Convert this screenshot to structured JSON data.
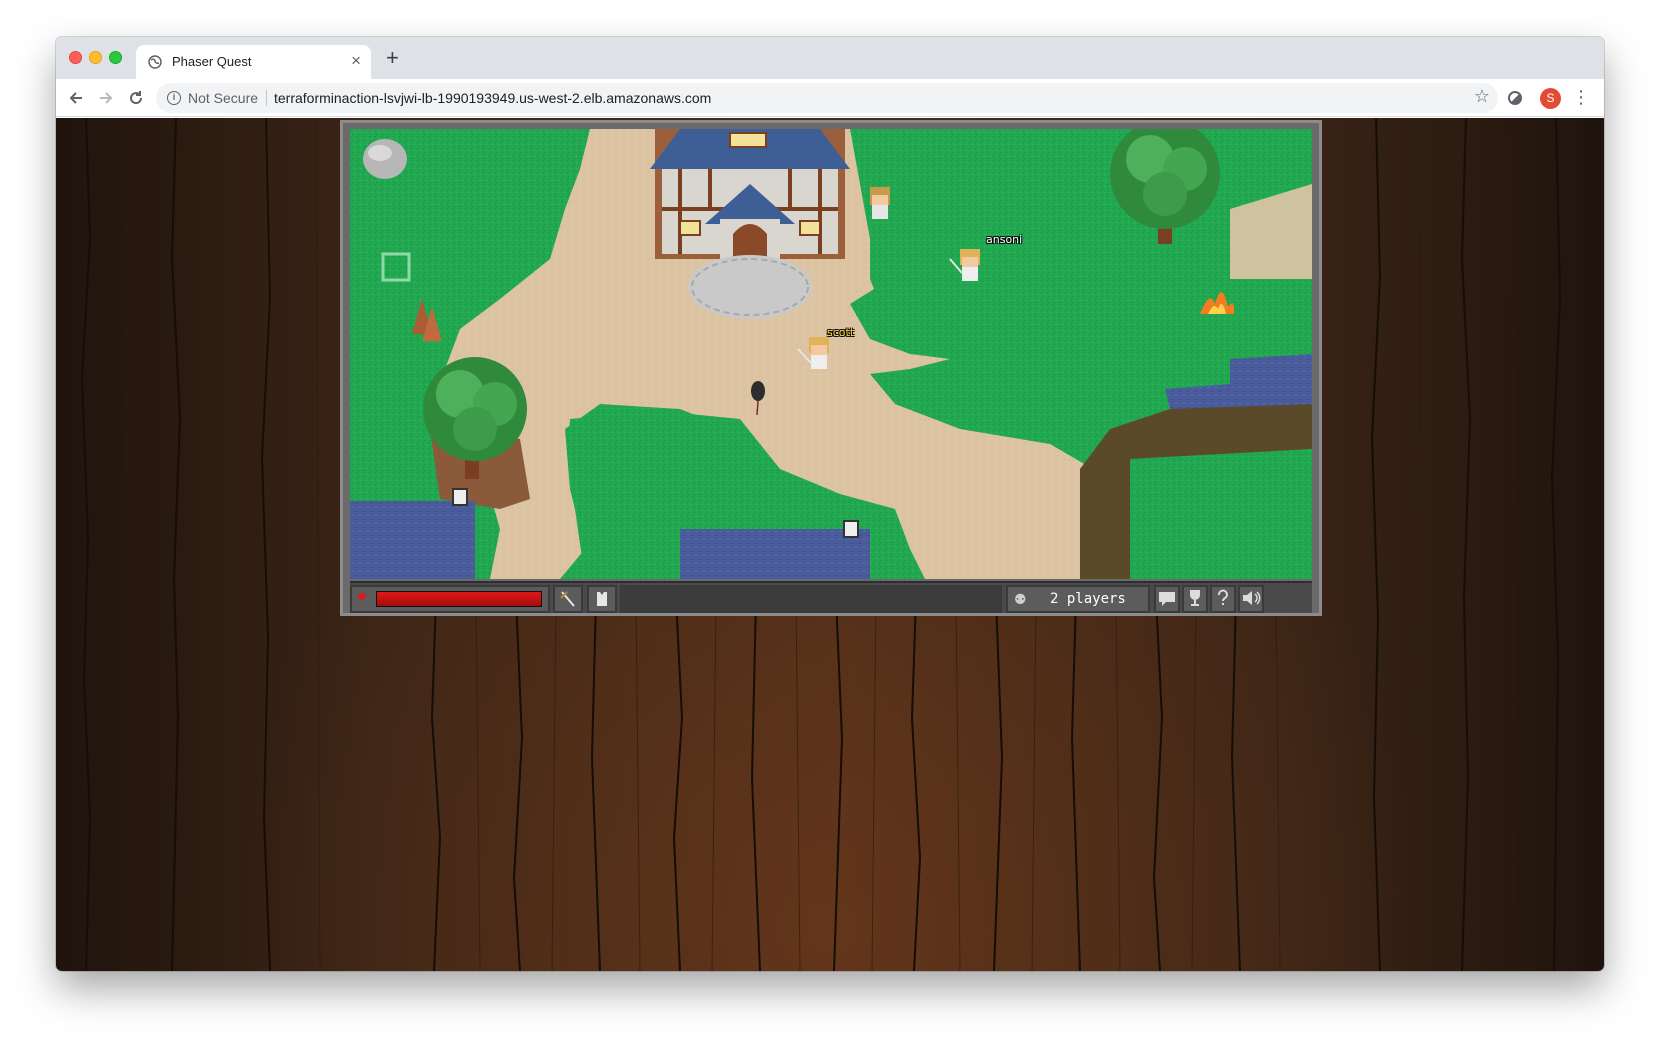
{
  "browser": {
    "tab_title": "Phaser Quest",
    "tab_close": "×",
    "new_tab": "+",
    "security_label": "Not Secure",
    "url": "terraforminaction-lsvjwi-lb-1990193949.us-west-2.elb.amazonaws.com",
    "profile_initial": "S",
    "icons": [
      "globe-icon",
      "close-icon",
      "plus-icon",
      "back-arrow-icon",
      "forward-arrow-icon",
      "reload-icon",
      "info-icon",
      "star-icon",
      "extension-icon",
      "kebab-menu-icon"
    ]
  },
  "game": {
    "players": [
      {
        "name": "scott",
        "color": "#f0d040"
      },
      {
        "name": "ansoni",
        "color": "#ffffff"
      }
    ],
    "hud": {
      "health": 1.0,
      "players_label": "2 players",
      "buttons": [
        "chat-icon",
        "achievements-icon",
        "help-icon",
        "sound-icon"
      ]
    }
  },
  "colors": {
    "grass": "#22a851",
    "path": "#dcc3a2",
    "water": "#4a5b9c",
    "health": "#c81414",
    "wood": "#3a2416"
  }
}
